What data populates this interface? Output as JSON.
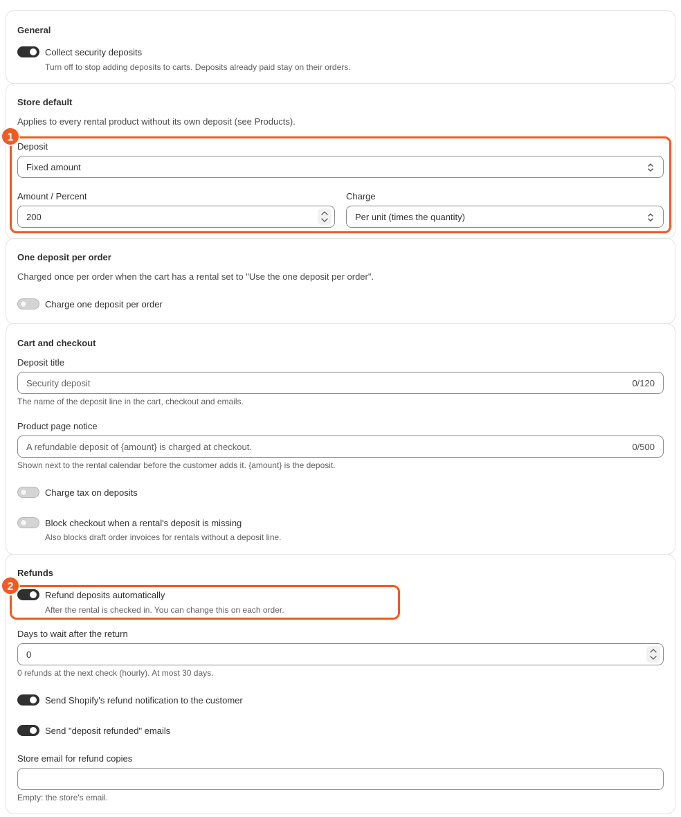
{
  "general": {
    "heading": "General",
    "collect_label": "Collect security deposits",
    "collect_help": "Turn off to stop adding deposits to carts. Deposits already paid stay on their orders."
  },
  "store_default": {
    "heading": "Store default",
    "description": "Applies to every rental product without its own deposit (see Products).",
    "deposit_label": "Deposit",
    "deposit_value": "Fixed amount",
    "amount_label": "Amount / Percent",
    "amount_value": "200",
    "charge_label": "Charge",
    "charge_value": "Per unit (times the quantity)"
  },
  "one_deposit": {
    "heading": "One deposit per order",
    "description": "Charged once per order when the cart has a rental set to \"Use the one deposit per order\".",
    "toggle_label": "Charge one deposit per order"
  },
  "cart": {
    "heading": "Cart and checkout",
    "title_label": "Deposit title",
    "title_placeholder": "Security deposit",
    "title_count": "0/120",
    "title_help": "The name of the deposit line in the cart, checkout and emails.",
    "notice_label": "Product page notice",
    "notice_placeholder": "A refundable deposit of {amount} is charged at checkout.",
    "notice_count": "0/500",
    "notice_help": "Shown next to the rental calendar before the customer adds it. {amount} is the deposit.",
    "tax_label": "Charge tax on deposits",
    "block_label": "Block checkout when a rental's deposit is missing",
    "block_help": "Also blocks draft order invoices for rentals without a deposit line."
  },
  "refunds": {
    "heading": "Refunds",
    "auto_label": "Refund deposits automatically",
    "auto_help": "After the rental is checked in. You can change this on each order.",
    "days_label": "Days to wait after the return",
    "days_value": "0",
    "days_help": "0 refunds at the next check (hourly). At most 30 days.",
    "shopify_label": "Send Shopify's refund notification to the customer",
    "emails_label": "Send \"deposit refunded\" emails",
    "store_email_label": "Store email for refund copies",
    "store_email_value": "",
    "store_email_help": "Empty: the store's email."
  },
  "callouts": {
    "one": "1",
    "two": "2"
  },
  "colors": {
    "accent": "#f15a22",
    "toggle_on": "#303030",
    "toggle_off": "#d4d4d4"
  }
}
